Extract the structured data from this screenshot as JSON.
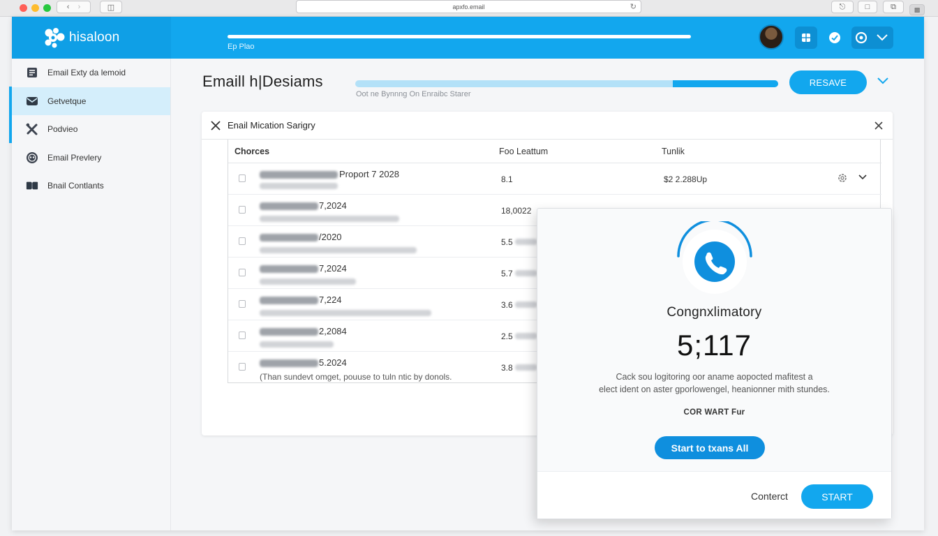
{
  "browser": {
    "url": "apxfo.email",
    "colors": {
      "close": "#ff5f57",
      "minimize": "#febc2e",
      "maximize": "#28c840"
    }
  },
  "app": {
    "logo_text": "hisaloon",
    "topbar_caption": "Ep Plao",
    "brand_color": "#12a7ee"
  },
  "sidebar": {
    "items": [
      {
        "label": "Email Exty da lemoid",
        "icon": "list-icon"
      },
      {
        "label": "Getvetque",
        "icon": "envelope-icon"
      },
      {
        "label": "Podvieo",
        "icon": "tools-icon"
      },
      {
        "label": "Email Prevlery",
        "icon": "preview-icon"
      },
      {
        "label": "Bnail Contlants",
        "icon": "book-icon"
      }
    ]
  },
  "header": {
    "title": "Emaill h|Desiams",
    "subtitle": "Oot ne Bynnng On Enraibc Starer",
    "progress": 0.25,
    "resave_label": "RESAVE"
  },
  "card": {
    "title": "Enail Mication Sarigry",
    "columns": [
      "Chorces",
      "Foo Leattum",
      "Tunlik"
    ],
    "rows": [
      {
        "title": "Proport 7 2028",
        "value": "8.1",
        "total": "$2 2.288Up",
        "sub": ""
      },
      {
        "title": "7,2024",
        "value": "18,0022",
        "total": "",
        "sub": ""
      },
      {
        "title": "/2020",
        "value": "5.5",
        "total": "",
        "sub": ""
      },
      {
        "title": "7,2024",
        "value": "5.7",
        "total": "",
        "sub": ""
      },
      {
        "title": "7,224",
        "value": "3.6",
        "total": "",
        "sub": ""
      },
      {
        "title": "2,2084",
        "value": "2.5",
        "total": "",
        "sub": ""
      },
      {
        "title": "5.2024",
        "value": "3.8",
        "total": "",
        "sub": "(Than sundevt omget, pouuse to tuln ntic by donols."
      }
    ]
  },
  "modal": {
    "heading": "Congnxlimatory",
    "count": "5;117",
    "body_line1": "Cack sou logitoring oor aname aopocted mafitest a",
    "body_line2": "elect ident on aster gporlowengel, heanionner mith stundes.",
    "tag": "COR WART Fur",
    "cta_label": "Start to txans All",
    "link_label": "Conterct",
    "start_label": "START",
    "accent": "#0f8fde"
  }
}
